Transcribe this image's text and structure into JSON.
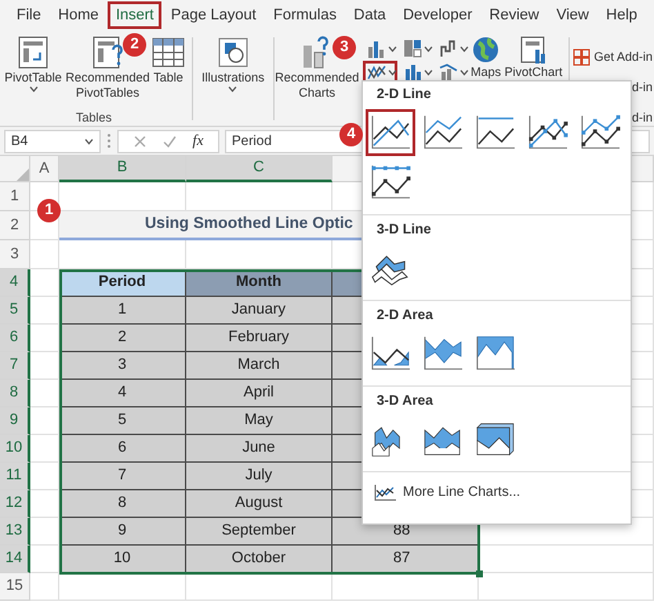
{
  "ribbon_tabs": [
    {
      "label": "File",
      "selected": false
    },
    {
      "label": "Home",
      "selected": false
    },
    {
      "label": "Insert",
      "selected": true
    },
    {
      "label": "Page Layout",
      "selected": false
    },
    {
      "label": "Formulas",
      "selected": false
    },
    {
      "label": "Data",
      "selected": false
    },
    {
      "label": "Developer",
      "selected": false
    },
    {
      "label": "Review",
      "selected": false
    },
    {
      "label": "View",
      "selected": false
    },
    {
      "label": "Help",
      "selected": false
    }
  ],
  "ribbon": {
    "tables_group": {
      "label": "Tables",
      "buttons": [
        {
          "label": "PivotTable",
          "dropdown": true
        },
        {
          "label": "Recommended PivotTables",
          "dropdown": false
        },
        {
          "label": "Table",
          "dropdown": false
        }
      ]
    },
    "illustrations": {
      "label": "Illustrations",
      "dropdown": true
    },
    "recommended_charts": {
      "label": "Recommended Charts"
    },
    "chart_type_buttons": [
      {
        "selected": false
      },
      {
        "selected": false
      },
      {
        "selected": false
      },
      {
        "selected": true
      },
      {
        "selected": false
      },
      {
        "selected": false
      }
    ],
    "maps": {
      "label": "Maps"
    },
    "pivotchart": {
      "label": "PivotChart"
    },
    "add_ins": {
      "label": "Get Add-in",
      "partial_labels": [
        "d-in",
        "d-in"
      ]
    }
  },
  "formula_bar": {
    "name_box": "B4",
    "fx": "fx",
    "formula": "Period"
  },
  "sheet": {
    "columns": [
      {
        "label": "A",
        "selected": false
      },
      {
        "label": "B",
        "selected": true
      },
      {
        "label": "C",
        "selected": true
      }
    ],
    "rows": [
      {
        "label": "1",
        "selected": false
      },
      {
        "label": "2",
        "selected": false
      },
      {
        "label": "3",
        "selected": false
      },
      {
        "label": "4",
        "selected": true
      },
      {
        "label": "5",
        "selected": true
      },
      {
        "label": "6",
        "selected": true
      },
      {
        "label": "7",
        "selected": true
      },
      {
        "label": "8",
        "selected": true
      },
      {
        "label": "9",
        "selected": true
      },
      {
        "label": "10",
        "selected": true
      },
      {
        "label": "11",
        "selected": true
      },
      {
        "label": "12",
        "selected": true
      },
      {
        "label": "13",
        "selected": true
      },
      {
        "label": "14",
        "selected": true
      },
      {
        "label": "15",
        "selected": false
      }
    ],
    "title": "Using Smoothed Line Optic",
    "table": {
      "headers": [
        "Period",
        "Month"
      ],
      "rows": [
        {
          "cells": [
            "1",
            "January"
          ]
        },
        {
          "cells": [
            "2",
            "February"
          ]
        },
        {
          "cells": [
            "3",
            "March"
          ]
        },
        {
          "cells": [
            "4",
            "April"
          ]
        },
        {
          "cells": [
            "5",
            "May"
          ]
        },
        {
          "cells": [
            "6",
            "June"
          ]
        },
        {
          "cells": [
            "7",
            "July"
          ]
        },
        {
          "cells": [
            "8",
            "August"
          ]
        },
        {
          "cells": [
            "9",
            "September",
            "88"
          ]
        },
        {
          "cells": [
            "10",
            "October",
            "87"
          ]
        }
      ]
    }
  },
  "chart_menu": {
    "sections": [
      {
        "title": "2-D Line",
        "items": [
          {
            "selected": true
          },
          {
            "selected": false
          },
          {
            "selected": false
          },
          {
            "selected": false
          },
          {
            "selected": false
          },
          {
            "selected": false
          }
        ]
      },
      {
        "title": "3-D Line",
        "items": [
          {
            "selected": false
          }
        ]
      },
      {
        "title": "2-D Area",
        "items": [
          {
            "selected": false
          },
          {
            "selected": false
          },
          {
            "selected": false
          }
        ]
      },
      {
        "title": "3-D Area",
        "items": [
          {
            "selected": false
          },
          {
            "selected": false
          },
          {
            "selected": false
          }
        ]
      }
    ],
    "footer": "More Line Charts..."
  },
  "callouts": [
    "1",
    "2",
    "3",
    "4"
  ]
}
